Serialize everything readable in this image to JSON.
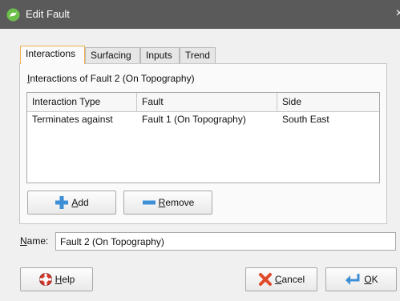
{
  "window": {
    "title": "Edit Fault",
    "close_glyph": "×"
  },
  "tabs": [
    {
      "label": "Interactions",
      "active": true
    },
    {
      "label": "Surfacing",
      "active": false
    },
    {
      "label": "Inputs",
      "active": false
    },
    {
      "label": "Trend",
      "active": false
    }
  ],
  "interactions": {
    "section_label_first": "I",
    "section_label_rest": "nteractions of Fault 2 (On Topography)",
    "columns": [
      "Interaction Type",
      "Fault",
      "Side"
    ],
    "rows": [
      {
        "interaction_type": "Terminates against",
        "fault": "Fault 1 (On Topography)",
        "side": "South East"
      }
    ],
    "add_mnemonic": "A",
    "add_rest": "dd",
    "remove_mnemonic": "R",
    "remove_rest": "emove"
  },
  "name_field": {
    "label_mnemonic": "N",
    "label_rest": "ame:",
    "value": "Fault 2 (On Topography)"
  },
  "footer": {
    "help_mnemonic": "H",
    "help_rest": "elp",
    "cancel_mnemonic": "C",
    "cancel_rest": "ancel",
    "ok_mnemonic": "O",
    "ok_rest": "K"
  },
  "icons": {
    "title": "leapfrog-app-icon",
    "add": "plus-icon",
    "remove": "minus-icon",
    "help": "lifebuoy-icon",
    "cancel": "cancel-x-icon",
    "ok": "return-arrow-icon"
  },
  "colors": {
    "titlebar": "#5a5a5a",
    "active_tab_border": "#f0b050",
    "add_icon_blue": "#3d8fd6",
    "help_icon_red": "#d33a2f",
    "cancel_icon_red": "#e04a2a"
  }
}
